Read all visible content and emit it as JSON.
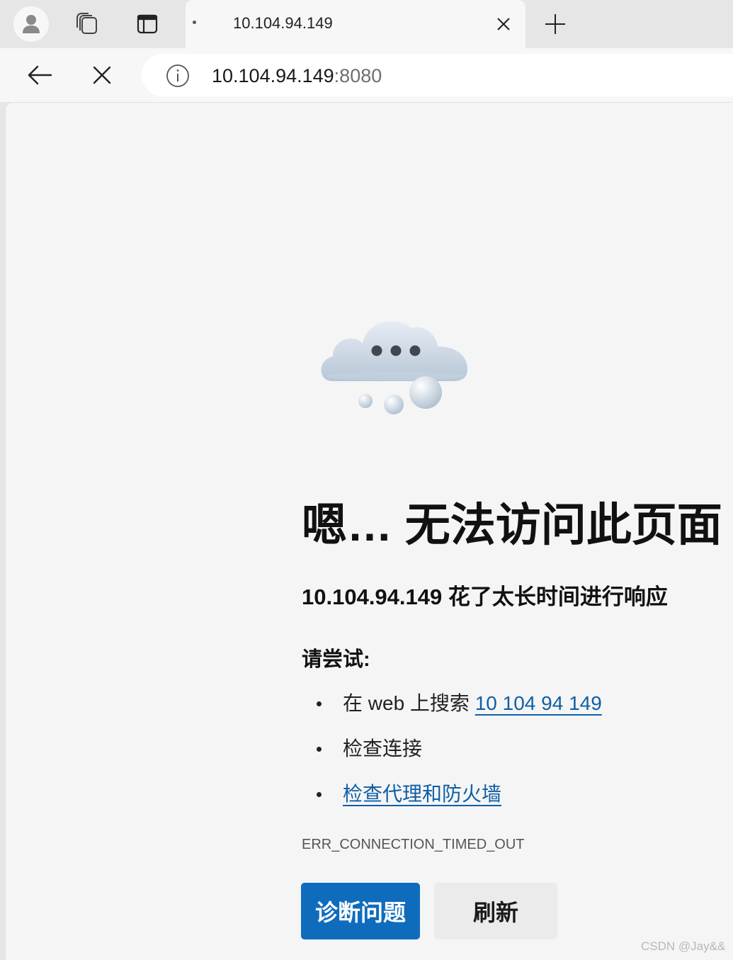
{
  "tab": {
    "title": "10.104.94.149"
  },
  "address_bar": {
    "host": "10.104.94.149",
    "port": ":8080"
  },
  "error_page": {
    "headline": "嗯… 无法访问此页面",
    "subhead": "10.104.94.149 花了太长时间进行响应",
    "try_label": "请尝试:",
    "suggestions": [
      {
        "prefix": "在 web 上搜索 ",
        "link": "10 104 94 149"
      },
      {
        "text": "检查连接"
      },
      {
        "link": "检查代理和防火墙"
      }
    ],
    "error_code": "ERR_CONNECTION_TIMED_OUT",
    "buttons": {
      "primary": "诊断问题",
      "secondary": "刷新"
    }
  },
  "watermark": "CSDN @Jay&&",
  "colors": {
    "accent": "#0f6cbd",
    "link": "#0f5fa6",
    "page_bg": "#f5f5f5",
    "chrome_bg": "#e6e6e6"
  },
  "icons": [
    "profile-icon",
    "workspaces-icon",
    "vertical-tabs-icon",
    "loading-dot-icon",
    "close-icon",
    "plus-icon",
    "back-arrow-icon",
    "stop-icon",
    "info-icon",
    "cloud-error-icon"
  ]
}
